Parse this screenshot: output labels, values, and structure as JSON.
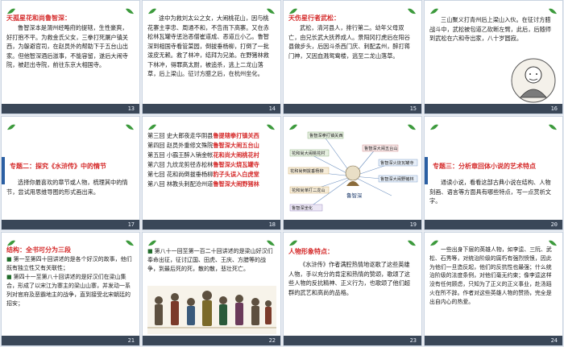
{
  "slides": [
    {
      "num": "13",
      "title": "天孤星花和尚鲁智深：",
      "body": "鲁智深本是渭州经略府的提辖，生性豪爽，好打抱不平。为救金氏父女，三拳打死屠户镇关西，为躲避官司，在赵员外的帮助下于五台山出家。但他智深酒后滋事，不能容留，遂后大闹寺院，被赶出寺院，前往东京大相国寺。"
    },
    {
      "num": "14",
      "body": "途中为救刘太公之女，大闹桃花山，因与桃花寨主李忠、周通不和，不告而下高寨。又在赤松林瓦罐寺惩治恶僧崔道成、恶道丘小乙。鲁智深到相国寺看管菜园，倒拔垂杨柳，打倒了一批泼皮无赖。救了林冲，结拜为兄弟。在野猪林救下林冲，得罪高太尉，被追杀，逃上二龙山落草，后上梁山。征讨方腊之后，在杭州坐化。"
    },
    {
      "num": "15",
      "title": "天伤星行者武松：",
      "body": "武松，清河县人，排行第二。幼年父母双亡，由兄长武大抚养成人。景阳冈打虎后在阳谷县做步头，后因斗杀西门庆、刺配孟州，醉打蒋门神，又因血溅鸳鸯楼，逃至二龙山落草。"
    },
    {
      "num": "16",
      "body": "三山聚义打青州后上梁山入伙。在征讨方腊战斗中，武松被包道乙砍断左臂，此后，后随师到武松在六和寺出家，八十岁圆寂。"
    },
    {
      "num": "17",
      "title": "专题二：探究《水浒传》中的情节",
      "body": "选择你最喜欢的章节或人物，梳理其中的情节，尝试用思维导图的形式画出来。"
    },
    {
      "num": "18",
      "rows": [
        {
          "a": "第三回 史大郎夜走华阴县",
          "b": "鲁提辖拳打镇关西"
        },
        {
          "a": "第四回 赵员外重修文殊院",
          "b": "鲁智深大闹五台山"
        },
        {
          "a": "第五回 小霸王醉入销金帐",
          "b": "花和尚大闹桃花村"
        },
        {
          "a": "第六回 九纹龙剪径赤松林",
          "b": "鲁智深火烧瓦罐寺"
        },
        {
          "a": "第七回 花和尚倒拔垂杨柳",
          "b": "豹子头误入白虎堂"
        },
        {
          "a": "第八回 林教头刺配沧州道",
          "b": "鲁智深大闹野猪林"
        }
      ]
    },
    {
      "num": "19",
      "center": "鲁智深",
      "nodes": [
        "鲁智深拳打镇关西",
        "鲁智深大闹五台山",
        "花和尚大闹桃花村",
        "鲁智深火烧瓦罐寺",
        "鲁智深大闹野猪林",
        "花和尚倒拔垂杨柳",
        "花和尚单打二龙山",
        "鲁智深坐化"
      ]
    },
    {
      "num": "20",
      "title": "专题三：分析章回体小说的艺术特点",
      "body": "通读小说，看看这部古典小说在结构、人物刻画、语言等方面具有哪些特点，写一点赏析文字。"
    },
    {
      "num": "21",
      "title": "结构：全书可分为三段",
      "items": [
        "第一至第四十回讲述的是各个好汉的故事，他们既有独立性又有关联性；",
        "第四十一至第八十回讲述的是好汉们在梁山集合，形成了以宋江为寨主的梁山山寨，并发动一系列对官府及恶霸地主的战争，直到接受北宋朝廷的招安；"
      ]
    },
    {
      "num": "22",
      "body": "第八十一回至第一百二十回讲述的是梁山好汉们奉命出征，征讨辽国、田虎、王庆、方腊等的战争，到最后死的死，散的散，悲壮死亡。"
    },
    {
      "num": "23",
      "title": "人物形象特点：",
      "body": "《水浒传》作者满腔热情地讴歌了这些英雄人物，手以充分的肯定和热情的赞颂，歌颂了这些人物的反抗精神、正义行为，也歌颂了他们超群的武艺和高尚的品格。"
    },
    {
      "num": "24",
      "body": "一些出身下层的英雄人物，如李逵、三阮、武松、石秀等，对统治阶级的腐朽有强烈愤恨，因此为他们一旦造反起，他们的反抗性也最强；什么统治阶级的法度条例，对他们毫无约束；像李逵这样没有任何顾虑，只知为了正义的正义事业，赴汤蹈火在所不辞。作者对这些英雄人物的赞扬，完全是出自内心的热爱。"
    }
  ],
  "colors": {
    "red_title": "#d52b2b",
    "footer": "#3a4758",
    "leaf": "#3c9a3c",
    "green_bullet": "#1f6b2a"
  },
  "icons": [
    "leaf-icon",
    "mindmap-center-figure",
    "monk-portrait",
    "hero-group-illustration"
  ]
}
